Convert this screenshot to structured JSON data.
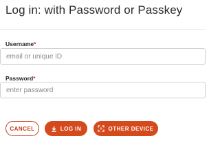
{
  "page": {
    "title": "Log in: with Password or Passkey"
  },
  "form": {
    "username": {
      "label": "Username",
      "required_mark": "*",
      "placeholder": "email or unique ID"
    },
    "password": {
      "label": "Password",
      "required_mark": "*",
      "placeholder": "enter password"
    }
  },
  "buttons": {
    "cancel": "CANCEL",
    "login": {
      "label": "LOG IN",
      "icon": "login-icon"
    },
    "other_device": {
      "label": "OTHER DEVICE",
      "icon": "qr-code-icon"
    }
  },
  "colors": {
    "accent": "#d54a1c",
    "required": "#d12c1e"
  }
}
